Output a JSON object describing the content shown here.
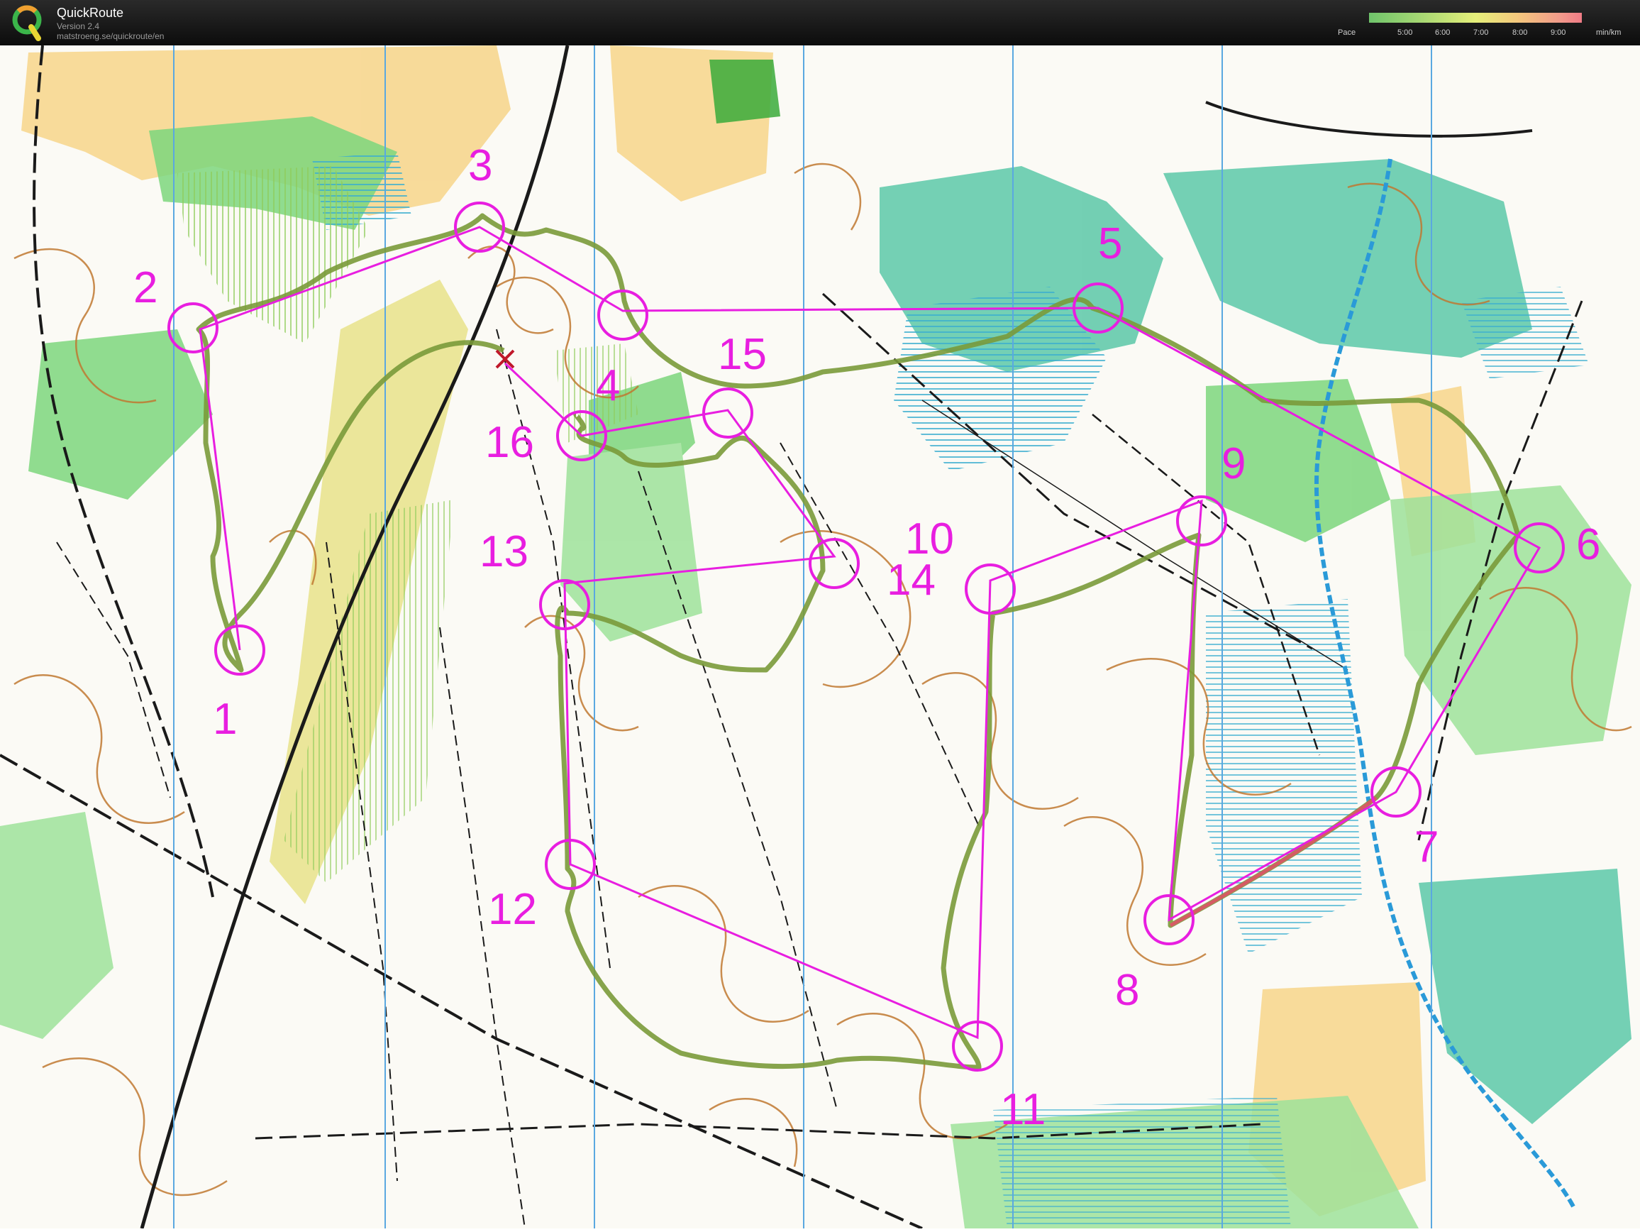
{
  "app": {
    "name": "QuickRoute",
    "version": "Version 2.4",
    "url": "matstroeng.se/quickroute/en"
  },
  "pace_legend": {
    "label": "Pace",
    "ticks": [
      "5:00",
      "6:00",
      "7:00",
      "8:00",
      "9:00"
    ],
    "unit": "min/km"
  },
  "colors": {
    "course": "#e81ee0",
    "route": "#7a9a3a",
    "contour": "#c07830",
    "vegetation_green": "#6fce6f",
    "marsh": "#4bbec8",
    "open_yellow": "#f7cf7a",
    "magnetic_north": "#5aa8e0"
  },
  "course": {
    "controls": [
      {
        "label": "1"
      },
      {
        "label": "2"
      },
      {
        "label": "3"
      },
      {
        "label": "4"
      },
      {
        "label": "5"
      },
      {
        "label": "6"
      },
      {
        "label": "7"
      },
      {
        "label": "8"
      },
      {
        "label": "9"
      },
      {
        "label": "10"
      },
      {
        "label": "11"
      },
      {
        "label": "12"
      },
      {
        "label": "13"
      },
      {
        "label": "14"
      },
      {
        "label": "15"
      },
      {
        "label": "16"
      }
    ]
  }
}
